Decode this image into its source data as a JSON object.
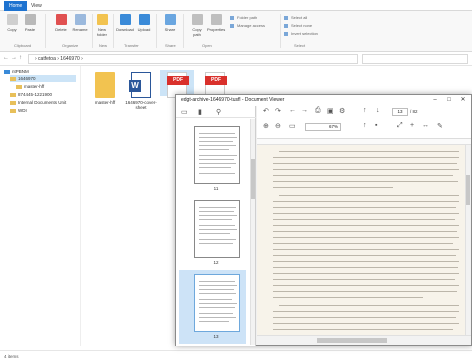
{
  "explorer": {
    "tabs": [
      "Home",
      "View"
    ],
    "ribbon": {
      "buttons": [
        "Copy",
        "Paste",
        "Delete",
        "Rename",
        "New folder",
        "Download",
        "Upload",
        "Share",
        "Copy path",
        "Properties"
      ],
      "groups": [
        "Clipboard",
        "Organize",
        "New",
        "Transfer",
        "Share",
        "Open",
        "Select"
      ],
      "small_items": [
        "Select all",
        "Select none",
        "Invert selection",
        "Folder path",
        "Manage access"
      ]
    },
    "address": {
      "back": "←",
      "forward": "→",
      "up": "↑",
      "path": "›  catfetoa  ›  1646970  ›"
    },
    "tree": [
      {
        "label": "ntPBNM"
      },
      {
        "label": "1646970"
      },
      {
        "label": "master-hff"
      },
      {
        "label": "874445-1221900"
      },
      {
        "label": "Internal Documents Unit"
      },
      {
        "label": "WDI"
      }
    ],
    "files": [
      {
        "label": "master-hff"
      },
      {
        "label": "1646970-cover-sheet"
      },
      {
        "label": "PDF"
      },
      {
        "label": "PDF"
      }
    ],
    "status": "4 items"
  },
  "viewer": {
    "title": "edgt-archive-1646970-tusfl - Document Viewer",
    "minimize": "–",
    "maximize": "□",
    "close": "✕",
    "page_current": "13",
    "page_total": "/ 82",
    "zoom": "67%",
    "thumb_labels": [
      "11",
      "12",
      "13"
    ]
  }
}
